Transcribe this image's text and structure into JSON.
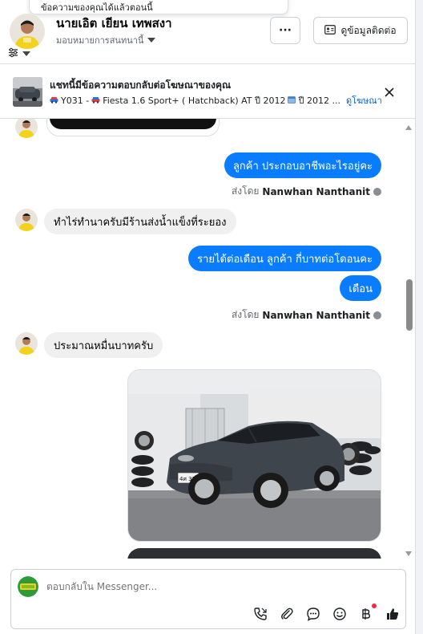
{
  "header": {
    "toast_text": "ข้อความของคุณได้แล้วตอนนี้",
    "contact_name": "นายเอิต เยียน เทพสงา",
    "assign_label": "มอบหมายการสนทนานี้",
    "more_label": "···",
    "contact_info_label": "ดูข้อมูลติดต่อ"
  },
  "ad": {
    "title": "แชทนี้มีข้อความตอบกลับต่อโฆษณาของคุณ",
    "code": "Y031 -",
    "model": "Fiesta 1.6 Sport+ ( Hatchback) AT ปี 2012",
    "year": "ปี 2012 ...",
    "link_label": "ดูโฆษณา"
  },
  "messages": [
    {
      "type": "out",
      "text": "ลูกค้า ประกอบอาชีพอะไรอยู่คะ"
    },
    {
      "type": "sent_by",
      "prefix": "ส่งโดย",
      "name": "Nanwhan Nanthanit"
    },
    {
      "type": "in",
      "text": "ทำไร่ทำนาครับมีร้านส่งน้ำแข็งที่ระยอง"
    },
    {
      "type": "out",
      "text": "รายได้ต่อเดือน ลูกค้า กี่บาทต่อโดอนคะ"
    },
    {
      "type": "out",
      "text": "เดือน"
    },
    {
      "type": "sent_by",
      "prefix": "ส่งโดย",
      "name": "Nanwhan Nanthanit"
    },
    {
      "type": "in",
      "text": "ประมาณหมื่นบาทครับ"
    }
  ],
  "car_plate": "4ศ 3742",
  "composer": {
    "placeholder": "ตอบกลับใน Messenger..."
  },
  "colors": {
    "accent": "#0a7cff",
    "bubble_in": "#f0f0f0",
    "link": "#0064d1"
  }
}
